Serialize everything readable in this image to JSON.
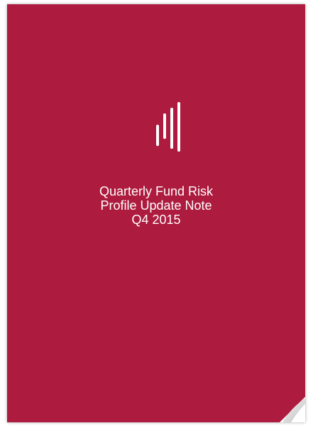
{
  "cover": {
    "title_lines": [
      "Quarterly Fund Risk",
      "Profile Update Note",
      "Q4 2015"
    ],
    "logo_icon": "vertical-bars-logo-icon",
    "curl_icon": "page-curl-icon",
    "colors": {
      "background": "#ad1b3e",
      "text": "#ffffff"
    }
  }
}
